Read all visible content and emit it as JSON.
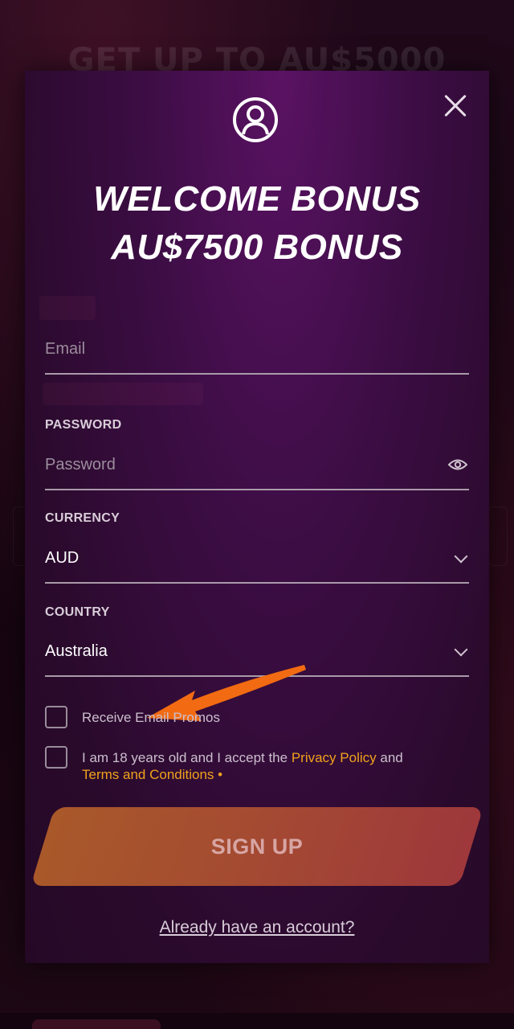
{
  "background": {
    "headline": "GET UP TO AU$5000"
  },
  "modal": {
    "title_line1": "WELCOME BONUS",
    "title_line2": "AU$7500 BONUS",
    "email": {
      "placeholder": "Email"
    },
    "password": {
      "label": "PASSWORD",
      "placeholder": "Password"
    },
    "currency": {
      "label": "CURRENCY",
      "value": "AUD"
    },
    "country": {
      "label": "COUNTRY",
      "value": "Australia"
    },
    "promos": {
      "text": "Receive Email Promos"
    },
    "terms": {
      "prefix": "I am 18 years old and I accept the ",
      "privacy_link": "Privacy Policy",
      "middle": " and",
      "terms_link": "Terms and Conditions",
      "required_mark": " •"
    },
    "signup_label": "SIGN UP",
    "already_link": "Already have an account?"
  },
  "colors": {
    "accent_link": "#f0a21c",
    "arrow": "#f26b12",
    "modal_bg": "#3c0d44"
  }
}
